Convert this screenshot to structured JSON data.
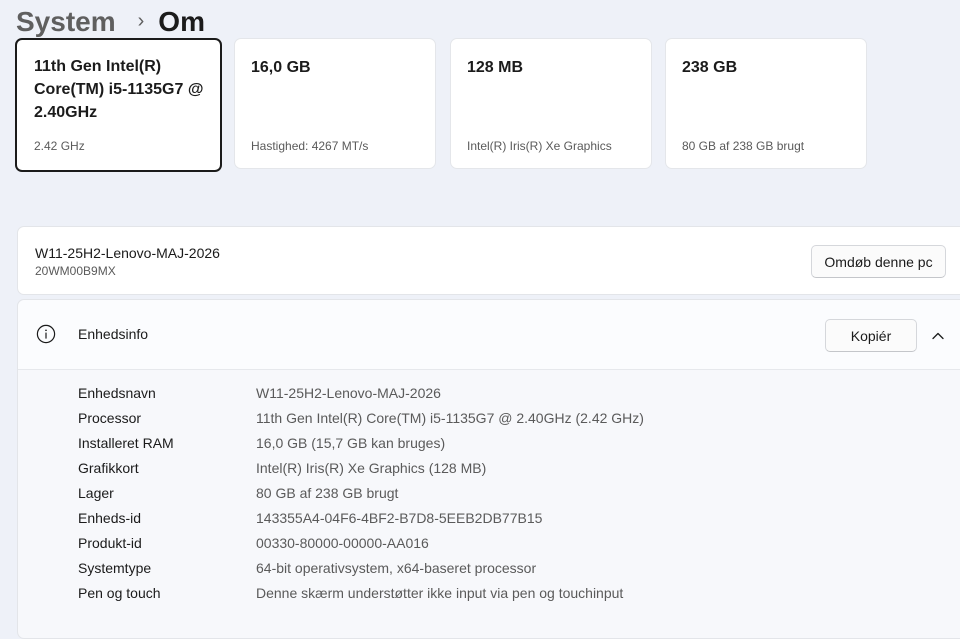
{
  "breadcrumb": {
    "parent": "System",
    "separator": "›",
    "current": "Om"
  },
  "specs": [
    {
      "value": "11th Gen Intel(R) Core(TM) i5-1135G7 @ 2.40GHz",
      "sub": "2.42 GHz",
      "icon": "processor-icon"
    },
    {
      "value": "16,0 GB",
      "sub": "Hastighed: 4267 MT/s",
      "icon": "memory-icon"
    },
    {
      "value": "128 MB",
      "sub": "Intel(R) Iris(R) Xe Graphics",
      "icon": "graphics-icon"
    },
    {
      "value": "238 GB",
      "sub": "80 GB af 238 GB brugt",
      "icon": "storage-icon"
    }
  ],
  "pc": {
    "name": "W11-25H2-Lenovo-MAJ-2026",
    "model": "20WM00B9MX",
    "rename_label": "Omdøb denne pc"
  },
  "device_info": {
    "title": "Enhedsinfo",
    "icon": "info-icon",
    "copy_label": "Kopiér",
    "collapse_icon": "chevron-up-icon",
    "rows": [
      {
        "label": "Enhedsnavn",
        "value": "W11-25H2-Lenovo-MAJ-2026"
      },
      {
        "label": "Processor",
        "value": "11th Gen Intel(R) Core(TM) i5-1135G7 @ 2.40GHz (2.42 GHz)"
      },
      {
        "label": "Installeret RAM",
        "value": "16,0 GB (15,7 GB kan bruges)"
      },
      {
        "label": "Grafikkort",
        "value": "Intel(R) Iris(R) Xe Graphics (128 MB)"
      },
      {
        "label": "Lager",
        "value": "80 GB af 238 GB brugt"
      },
      {
        "label": "Enheds-id",
        "value": "143355A4-04F6-4BF2-B7D8-5EEB2DB77B15"
      },
      {
        "label": "Produkt-id",
        "value": "00330-80000-00000-AA016"
      },
      {
        "label": "Systemtype",
        "value": "64-bit operativsystem, x64-baseret processor"
      },
      {
        "label": "Pen og touch",
        "value": "Denne skærm understøtter ikke input via pen og touchinput"
      }
    ]
  },
  "colors": {
    "page_background": "#eef1f8",
    "card_background": "#ffffff",
    "selected_border": "#1b1b1b",
    "secondary_text": "#5a5a5a"
  }
}
